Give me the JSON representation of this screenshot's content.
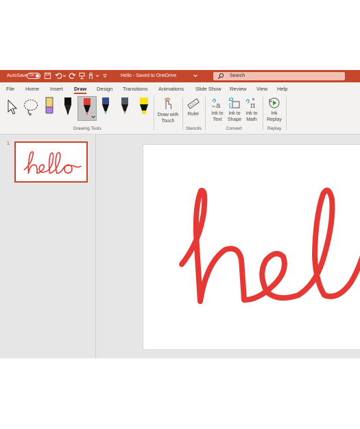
{
  "titlebar": {
    "autosave_label": "AutoSave",
    "toggle_label": "On",
    "doc_title": "Hello - Saved to OneDrive",
    "search_placeholder": "Search"
  },
  "tabs": [
    "File",
    "Home",
    "Insert",
    "Draw",
    "Design",
    "Transitions",
    "Animations",
    "Slide Show",
    "Review",
    "View",
    "Help"
  ],
  "active_tab": "Draw",
  "ribbon": {
    "drawing_tools_label": "Drawing Tools",
    "draw_with_touch": [
      "Draw with",
      "Touch"
    ],
    "ruler": "Ruler",
    "stencils_label": "Stencils",
    "ink_to_text": [
      "Ink to",
      "Text"
    ],
    "ink_to_shape": [
      "Ink to",
      "Shape"
    ],
    "ink_to_math": [
      "Ink to",
      "Math"
    ],
    "convert_label": "Convert",
    "ink_replay": [
      "Ink",
      "Replay"
    ],
    "replay_label": "Replay"
  },
  "slides": {
    "current_number": "1",
    "ink_color": "#e53935"
  },
  "colors": {
    "accent": "#c4472c",
    "ribbon_bg": "#f3f2f1",
    "workspace_bg": "#e6e6e6"
  },
  "icons": [
    "undo-icon",
    "redo-icon",
    "search-icon",
    "select-arrow-icon",
    "lasso-icon",
    "eraser-icon",
    "pen-icon",
    "highlighter-icon",
    "ruler-icon",
    "ink-replay-icon"
  ]
}
